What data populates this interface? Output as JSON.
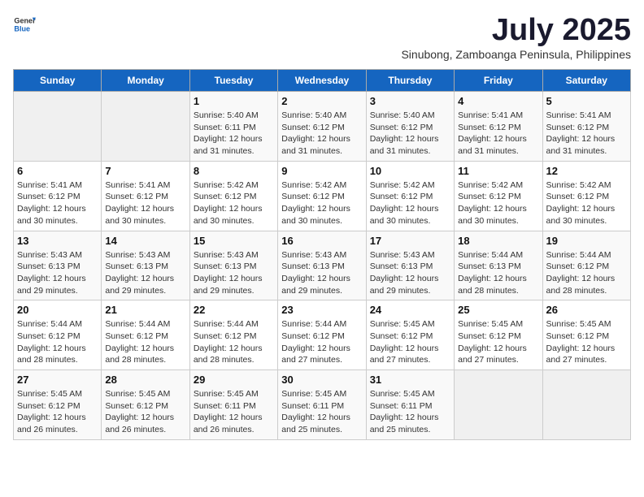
{
  "header": {
    "logo_general": "General",
    "logo_blue": "Blue",
    "month_title": "July 2025",
    "subtitle": "Sinubong, Zamboanga Peninsula, Philippines"
  },
  "calendar": {
    "days_of_week": [
      "Sunday",
      "Monday",
      "Tuesday",
      "Wednesday",
      "Thursday",
      "Friday",
      "Saturday"
    ],
    "weeks": [
      [
        {
          "day": "",
          "info": ""
        },
        {
          "day": "",
          "info": ""
        },
        {
          "day": "1",
          "info": "Sunrise: 5:40 AM\nSunset: 6:11 PM\nDaylight: 12 hours and 31 minutes."
        },
        {
          "day": "2",
          "info": "Sunrise: 5:40 AM\nSunset: 6:12 PM\nDaylight: 12 hours and 31 minutes."
        },
        {
          "day": "3",
          "info": "Sunrise: 5:40 AM\nSunset: 6:12 PM\nDaylight: 12 hours and 31 minutes."
        },
        {
          "day": "4",
          "info": "Sunrise: 5:41 AM\nSunset: 6:12 PM\nDaylight: 12 hours and 31 minutes."
        },
        {
          "day": "5",
          "info": "Sunrise: 5:41 AM\nSunset: 6:12 PM\nDaylight: 12 hours and 31 minutes."
        }
      ],
      [
        {
          "day": "6",
          "info": "Sunrise: 5:41 AM\nSunset: 6:12 PM\nDaylight: 12 hours and 30 minutes."
        },
        {
          "day": "7",
          "info": "Sunrise: 5:41 AM\nSunset: 6:12 PM\nDaylight: 12 hours and 30 minutes."
        },
        {
          "day": "8",
          "info": "Sunrise: 5:42 AM\nSunset: 6:12 PM\nDaylight: 12 hours and 30 minutes."
        },
        {
          "day": "9",
          "info": "Sunrise: 5:42 AM\nSunset: 6:12 PM\nDaylight: 12 hours and 30 minutes."
        },
        {
          "day": "10",
          "info": "Sunrise: 5:42 AM\nSunset: 6:12 PM\nDaylight: 12 hours and 30 minutes."
        },
        {
          "day": "11",
          "info": "Sunrise: 5:42 AM\nSunset: 6:12 PM\nDaylight: 12 hours and 30 minutes."
        },
        {
          "day": "12",
          "info": "Sunrise: 5:42 AM\nSunset: 6:12 PM\nDaylight: 12 hours and 30 minutes."
        }
      ],
      [
        {
          "day": "13",
          "info": "Sunrise: 5:43 AM\nSunset: 6:13 PM\nDaylight: 12 hours and 29 minutes."
        },
        {
          "day": "14",
          "info": "Sunrise: 5:43 AM\nSunset: 6:13 PM\nDaylight: 12 hours and 29 minutes."
        },
        {
          "day": "15",
          "info": "Sunrise: 5:43 AM\nSunset: 6:13 PM\nDaylight: 12 hours and 29 minutes."
        },
        {
          "day": "16",
          "info": "Sunrise: 5:43 AM\nSunset: 6:13 PM\nDaylight: 12 hours and 29 minutes."
        },
        {
          "day": "17",
          "info": "Sunrise: 5:43 AM\nSunset: 6:13 PM\nDaylight: 12 hours and 29 minutes."
        },
        {
          "day": "18",
          "info": "Sunrise: 5:44 AM\nSunset: 6:13 PM\nDaylight: 12 hours and 28 minutes."
        },
        {
          "day": "19",
          "info": "Sunrise: 5:44 AM\nSunset: 6:12 PM\nDaylight: 12 hours and 28 minutes."
        }
      ],
      [
        {
          "day": "20",
          "info": "Sunrise: 5:44 AM\nSunset: 6:12 PM\nDaylight: 12 hours and 28 minutes."
        },
        {
          "day": "21",
          "info": "Sunrise: 5:44 AM\nSunset: 6:12 PM\nDaylight: 12 hours and 28 minutes."
        },
        {
          "day": "22",
          "info": "Sunrise: 5:44 AM\nSunset: 6:12 PM\nDaylight: 12 hours and 28 minutes."
        },
        {
          "day": "23",
          "info": "Sunrise: 5:44 AM\nSunset: 6:12 PM\nDaylight: 12 hours and 27 minutes."
        },
        {
          "day": "24",
          "info": "Sunrise: 5:45 AM\nSunset: 6:12 PM\nDaylight: 12 hours and 27 minutes."
        },
        {
          "day": "25",
          "info": "Sunrise: 5:45 AM\nSunset: 6:12 PM\nDaylight: 12 hours and 27 minutes."
        },
        {
          "day": "26",
          "info": "Sunrise: 5:45 AM\nSunset: 6:12 PM\nDaylight: 12 hours and 27 minutes."
        }
      ],
      [
        {
          "day": "27",
          "info": "Sunrise: 5:45 AM\nSunset: 6:12 PM\nDaylight: 12 hours and 26 minutes."
        },
        {
          "day": "28",
          "info": "Sunrise: 5:45 AM\nSunset: 6:12 PM\nDaylight: 12 hours and 26 minutes."
        },
        {
          "day": "29",
          "info": "Sunrise: 5:45 AM\nSunset: 6:11 PM\nDaylight: 12 hours and 26 minutes."
        },
        {
          "day": "30",
          "info": "Sunrise: 5:45 AM\nSunset: 6:11 PM\nDaylight: 12 hours and 25 minutes."
        },
        {
          "day": "31",
          "info": "Sunrise: 5:45 AM\nSunset: 6:11 PM\nDaylight: 12 hours and 25 minutes."
        },
        {
          "day": "",
          "info": ""
        },
        {
          "day": "",
          "info": ""
        }
      ]
    ]
  }
}
